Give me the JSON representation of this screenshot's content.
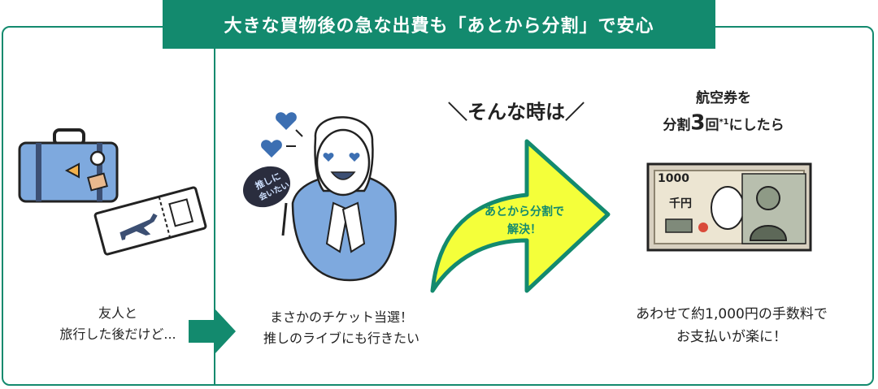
{
  "banner": {
    "title": "大きな買物後の急な出費も「あとから分割」で安心"
  },
  "step1": {
    "caption_line1": "友人と",
    "caption_line2": "旅行した後だけど..."
  },
  "step2": {
    "caption_line1": "まさかのチケット当選！",
    "caption_line2": "推しのライブにも行きたい",
    "fan_text_line1": "推しに",
    "fan_text_line2": "会いたい"
  },
  "step3": {
    "slogan": "＼そんな時は／",
    "arrow_text_line1": "あとから分割で",
    "arrow_text_line2": "解決！"
  },
  "step4": {
    "heading_line1": "航空券を",
    "heading_prefix": "分割",
    "heading_number": "3",
    "heading_unit": "回",
    "heading_note": "*1",
    "heading_suffix": "にしたら",
    "banknote_number": "1000",
    "banknote_label": "千円",
    "caption_line1": "あわせて約1,000円の手数料で",
    "caption_line2": "お支払いが楽に！"
  },
  "colors": {
    "brand_green": "#138a6e",
    "arrow_yellow": "#f4ff3a",
    "suitcase_blue": "#7ea9de",
    "shirt_blue": "#7ea9de"
  }
}
